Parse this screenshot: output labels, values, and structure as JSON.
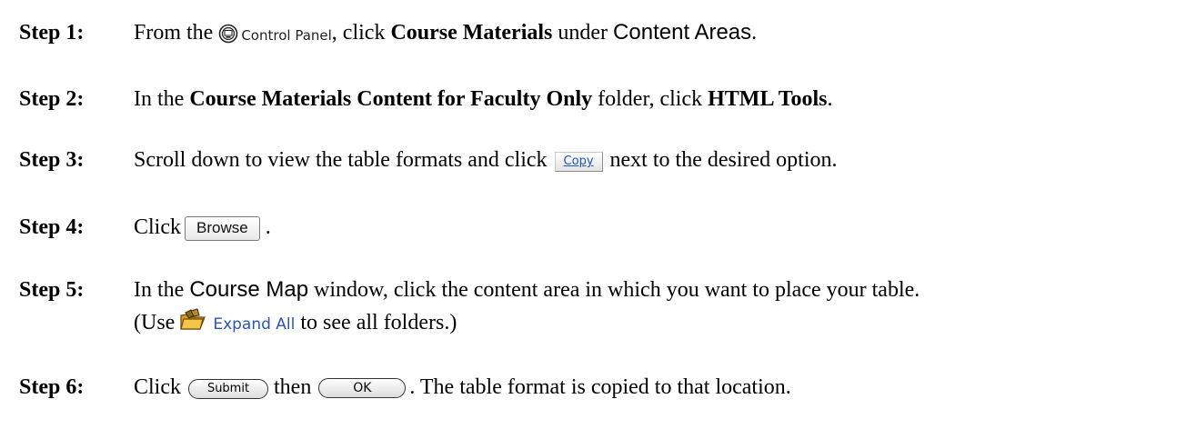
{
  "steps": [
    {
      "label": "Step 1:",
      "parts": {
        "pre": "From the",
        "control_panel": "Control Panel",
        "mid": ", click",
        "bold": "Course Materials",
        "under": "under",
        "sans": "Content Areas",
        "end": "."
      }
    },
    {
      "label": "Step 2:",
      "parts": {
        "pre": "In the",
        "bold1": "Course Materials Content for Faculty Only",
        "mid": "folder, click",
        "bold2": "HTML Tools",
        "end": "."
      }
    },
    {
      "label": "Step 3:",
      "parts": {
        "pre": "Scroll down to view the table formats and click",
        "copy_button": "Copy",
        "post": "next to the desired option."
      }
    },
    {
      "label": "Step 4:",
      "parts": {
        "pre": "Click",
        "browse_button": "Browse",
        "end": "."
      }
    },
    {
      "label": "Step 5:",
      "parts": {
        "pre": "In the",
        "sans": "Course Map",
        "post": "window, click the content area in which you want to place your table.",
        "line2_pre": "(Use",
        "expand_all": "Expand All",
        "line2_post": "to see all folders.)"
      }
    },
    {
      "label": "Step 6:",
      "parts": {
        "pre": "Click",
        "submit_button": "Submit",
        "mid": "then",
        "ok_button": "OK",
        "end": ". The table format is copied to that location."
      }
    }
  ],
  "icons": {
    "control_panel": "control-panel-icon",
    "expand_all": "folder-expand-icon"
  },
  "colors": {
    "link_blue": "#2a56b0",
    "copy_blue": "#1f56b6"
  }
}
